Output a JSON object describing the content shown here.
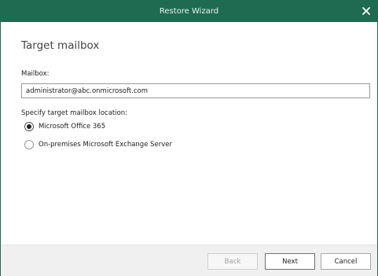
{
  "window": {
    "title": "Restore Wizard",
    "close_icon": "close-icon",
    "accent_color": "#1e6b52"
  },
  "page": {
    "heading": "Target mailbox",
    "mailbox_label": "Mailbox:",
    "mailbox_value": "administrator@abc.onmicrosoft.com",
    "location_label": "Specify target mailbox location:",
    "options": [
      {
        "label": "Microsoft Office 365",
        "selected": true
      },
      {
        "label": "On-premises Microsoft Exchange Server",
        "selected": false
      }
    ]
  },
  "footer": {
    "back_label": "Back",
    "back_enabled": false,
    "next_label": "Next",
    "cancel_label": "Cancel"
  }
}
